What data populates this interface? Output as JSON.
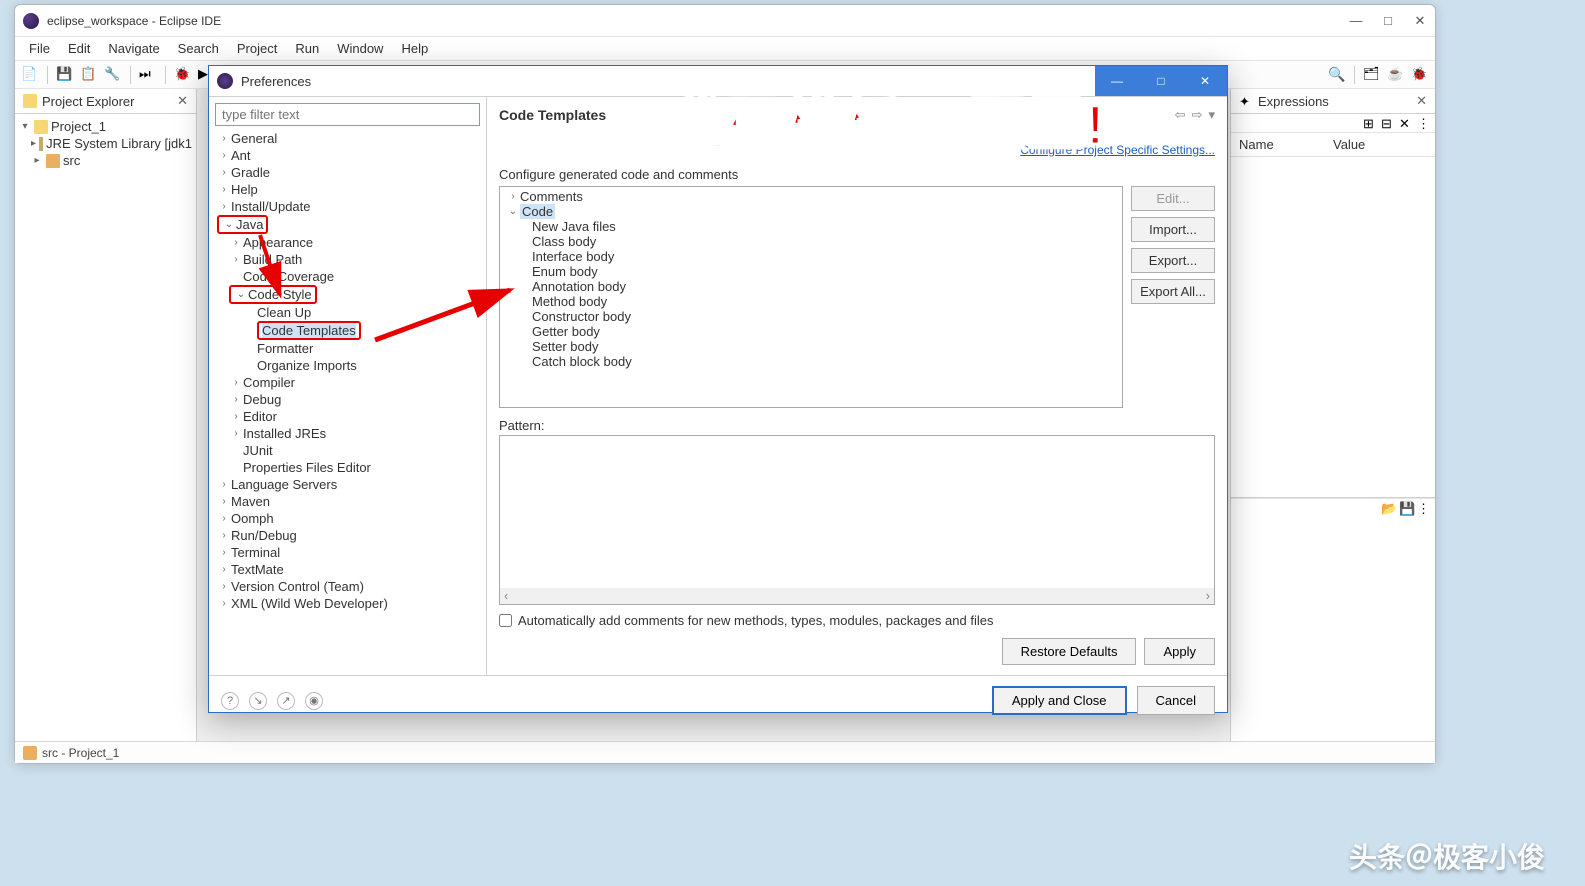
{
  "window": {
    "title": "eclipse_workspace - Eclipse IDE",
    "minimize": "—",
    "maximize": "□",
    "close": "✕"
  },
  "menubar": [
    "File",
    "Edit",
    "Navigate",
    "Search",
    "Project",
    "Run",
    "Window",
    "Help"
  ],
  "project_explorer": {
    "title": "Project Explorer",
    "close": "✕",
    "root": "Project_1",
    "jre": "JRE System Library [jdk1",
    "src": "src"
  },
  "expressions": {
    "title": "Expressions",
    "close": "✕",
    "col_name": "Name",
    "col_value": "Value"
  },
  "statusbar": {
    "text": "src - Project_1"
  },
  "dialog": {
    "title": "Preferences",
    "minimize": "—",
    "maximize": "□",
    "close": "✕",
    "filter_placeholder": "type filter text",
    "tree": {
      "general": "General",
      "ant": "Ant",
      "gradle": "Gradle",
      "help": "Help",
      "install": "Install/Update",
      "java": "Java",
      "appearance": "Appearance",
      "build_path": "Build Path",
      "code_coverage": "Code Coverage",
      "code_style": "Code Style",
      "clean_up": "Clean Up",
      "code_templates": "Code Templates",
      "formatter": "Formatter",
      "organize_imports": "Organize Imports",
      "compiler": "Compiler",
      "debug": "Debug",
      "editor": "Editor",
      "installed_jres": "Installed JREs",
      "junit": "JUnit",
      "properties_editor": "Properties Files Editor",
      "language_servers": "Language Servers",
      "maven": "Maven",
      "oomph": "Oomph",
      "run_debug": "Run/Debug",
      "terminal": "Terminal",
      "textmate": "TextMate",
      "version_control": "Version Control (Team)",
      "xml": "XML (Wild Web Developer)"
    },
    "heading": "Code Templates",
    "link": "Configure Project Specific Settings...",
    "desc": "Configure generated code and comments",
    "template_tree": {
      "comments": "Comments",
      "code": "Code",
      "new_java": "New Java files",
      "class_body": "Class body",
      "interface_body": "Interface body",
      "enum_body": "Enum body",
      "annotation_body": "Annotation body",
      "method_body": "Method body",
      "constructor_body": "Constructor body",
      "getter_body": "Getter body",
      "setter_body": "Setter body",
      "catch_block_body": "Catch block body"
    },
    "buttons": {
      "edit": "Edit...",
      "import": "Import...",
      "export": "Export...",
      "export_all": "Export All...",
      "restore": "Restore Defaults",
      "apply": "Apply",
      "apply_close": "Apply and Close",
      "cancel": "Cancel"
    },
    "pattern_label": "Pattern:",
    "checkbox_label": "Automatically add comments for new methods, types, modules, packages and files"
  },
  "annotation": {
    "text1": "代码模板",
    "text2": "配置!"
  },
  "watermark": "头条＠极客小俊"
}
